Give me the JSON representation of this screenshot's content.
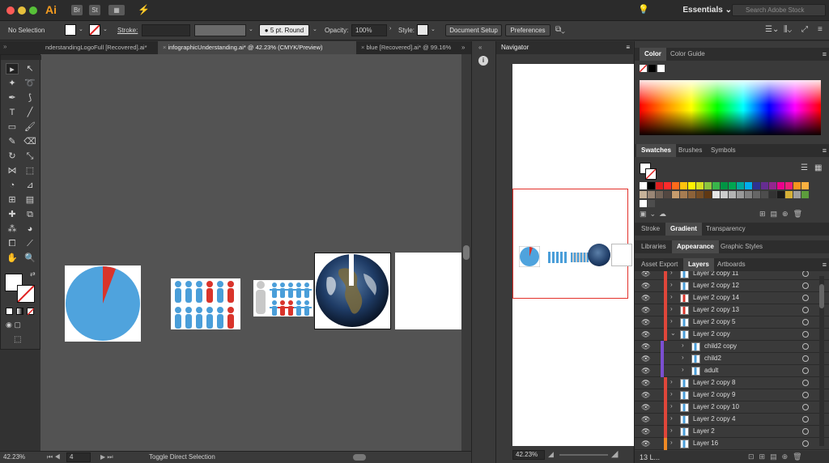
{
  "titlebar": {
    "app_icon": "Ai",
    "br_label": "Br",
    "st_label": "St",
    "workspace": "Essentials",
    "search_placeholder": "Search Adobe Stock"
  },
  "controlbar": {
    "selection": "No Selection",
    "stroke_label": "Stroke:",
    "brush": "5 pt. Round",
    "opacity_label": "Opacity:",
    "opacity_value": "100%",
    "style_label": "Style:",
    "doc_setup": "Document Setup",
    "preferences": "Preferences"
  },
  "tabs": [
    {
      "label": "nderstandingLogoFull [Recovered].ai*"
    },
    {
      "label": "infographicUnderstanding.ai* @ 42.23% (CMYK/Preview)"
    },
    {
      "label": "blue [Recovered].ai* @ 99.16%"
    }
  ],
  "status": {
    "zoom": "42.23%",
    "artboard": "4",
    "tool_hint": "Toggle Direct Selection"
  },
  "navigator": {
    "title": "Navigator",
    "zoom": "42.23%"
  },
  "color_panel": {
    "tabs": [
      "Color",
      "Color Guide"
    ],
    "active": "Color"
  },
  "swatches_panel": {
    "tabs": [
      "Swatches",
      "Brushes",
      "Symbols"
    ],
    "active": "Swatches",
    "row1": [
      "#ffffff",
      "#000000",
      "#e02020",
      "#ff2b2b",
      "#ff6a1a",
      "#ffc20e",
      "#fff200",
      "#d7e021",
      "#8cc63f",
      "#39b54a",
      "#009444",
      "#00a651",
      "#00a99d",
      "#00aeef",
      "#2e3192",
      "#662d91",
      "#92278f",
      "#ec008c",
      "#ed1e79",
      "#f7941d",
      "#fbb040"
    ],
    "row2": [
      "#c7b299",
      "#998675",
      "#736357",
      "#534741",
      "#c69c6d",
      "#a67c52",
      "#8c6239",
      "#754c24",
      "#603813",
      "#e6e6e6",
      "#cccccc",
      "#b3b3b3",
      "#999999",
      "#808080",
      "#666666",
      "#4d4d4d",
      "#333333",
      "#1a1a1a",
      "#d4af37",
      "#9e9e9e",
      "#5c9c3c"
    ],
    "row3": [
      "#ffffff",
      "#4d4d4d"
    ]
  },
  "stroke_panel": {
    "tabs": [
      "Stroke",
      "Gradient",
      "Transparency"
    ],
    "active": "Gradient"
  },
  "libraries_panel": {
    "tabs": [
      "Libraries",
      "Appearance",
      "Graphic Styles"
    ],
    "active": "Appearance"
  },
  "layers_panel": {
    "tabs": [
      "Asset Export",
      "Layers",
      "Artboards"
    ],
    "active": "Layers",
    "footer": "13 L...",
    "layers": [
      {
        "name": "Layer 2 copy 11",
        "indent": 0,
        "color": "#e0463a",
        "expanded": false
      },
      {
        "name": "Layer 2 copy 12",
        "indent": 0,
        "color": "#e0463a",
        "expanded": false
      },
      {
        "name": "Layer 2 copy 14",
        "indent": 0,
        "color": "#e0463a",
        "expanded": false
      },
      {
        "name": "Layer 2 copy 13",
        "indent": 0,
        "color": "#e0463a",
        "expanded": false
      },
      {
        "name": "Layer 2 copy 5",
        "indent": 0,
        "color": "#e0463a",
        "expanded": false
      },
      {
        "name": "Layer 2 copy",
        "indent": 0,
        "color": "#e0463a",
        "expanded": true
      },
      {
        "name": "child2 copy",
        "indent": 1,
        "color": "#7b4fd1",
        "expanded": false
      },
      {
        "name": "child2",
        "indent": 1,
        "color": "#7b4fd1",
        "expanded": false
      },
      {
        "name": "adult",
        "indent": 1,
        "color": "#7b4fd1",
        "expanded": false
      },
      {
        "name": "Layer 2 copy 8",
        "indent": 0,
        "color": "#e0463a",
        "expanded": false
      },
      {
        "name": "Layer 2 copy 9",
        "indent": 0,
        "color": "#e0463a",
        "expanded": false
      },
      {
        "name": "Layer 2 copy 10",
        "indent": 0,
        "color": "#e0463a",
        "expanded": false
      },
      {
        "name": "Layer 2 copy 4",
        "indent": 0,
        "color": "#e0463a",
        "expanded": false
      },
      {
        "name": "Layer 2",
        "indent": 0,
        "color": "#e0463a",
        "expanded": false
      },
      {
        "name": "Layer 16",
        "indent": 0,
        "color": "#f08a24",
        "expanded": false
      }
    ]
  },
  "colors": {
    "pie_blue": "#4fa3dd",
    "pie_red": "#d9342b",
    "people_blue": "#4a9ed9",
    "people_red": "#d9342b",
    "people_grey": "#c8c8c8"
  }
}
